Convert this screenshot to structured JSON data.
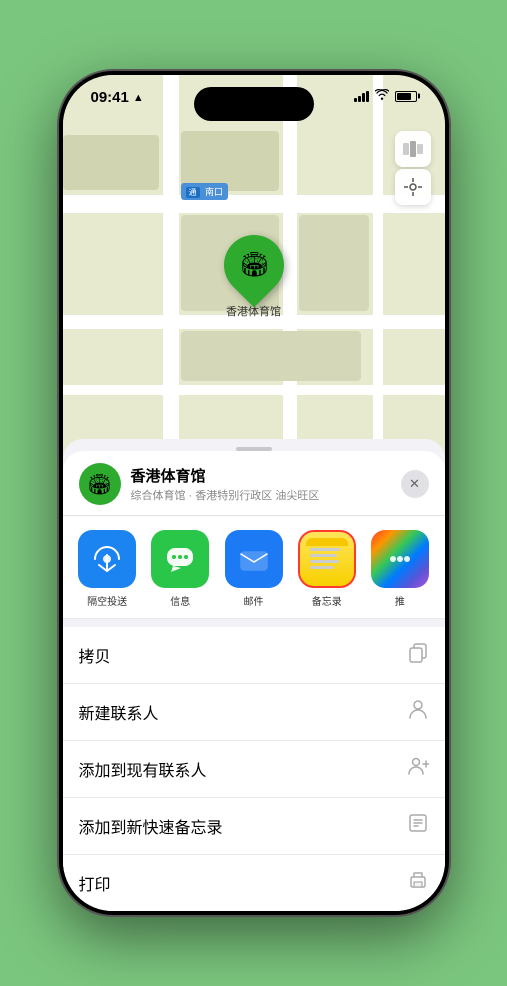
{
  "status_bar": {
    "time": "09:41",
    "location_arrow": "▶"
  },
  "map": {
    "road_label": "南口",
    "pin_label": "香港体育馆",
    "pin_emoji": "🏟"
  },
  "location_card": {
    "name": "香港体育馆",
    "subtitle": "综合体育馆 · 香港特别行政区 油尖旺区",
    "icon_emoji": "🏟",
    "close_label": "✕"
  },
  "share_items": [
    {
      "label": "隔空投送",
      "type": "airdrop"
    },
    {
      "label": "信息",
      "type": "messages"
    },
    {
      "label": "邮件",
      "type": "mail"
    },
    {
      "label": "备忘录",
      "type": "notes",
      "selected": true
    },
    {
      "label": "推",
      "type": "more"
    }
  ],
  "actions": [
    {
      "label": "拷贝",
      "icon": "copy"
    },
    {
      "label": "新建联系人",
      "icon": "person"
    },
    {
      "label": "添加到现有联系人",
      "icon": "person-add"
    },
    {
      "label": "添加到新快速备忘录",
      "icon": "note"
    },
    {
      "label": "打印",
      "icon": "print"
    }
  ]
}
